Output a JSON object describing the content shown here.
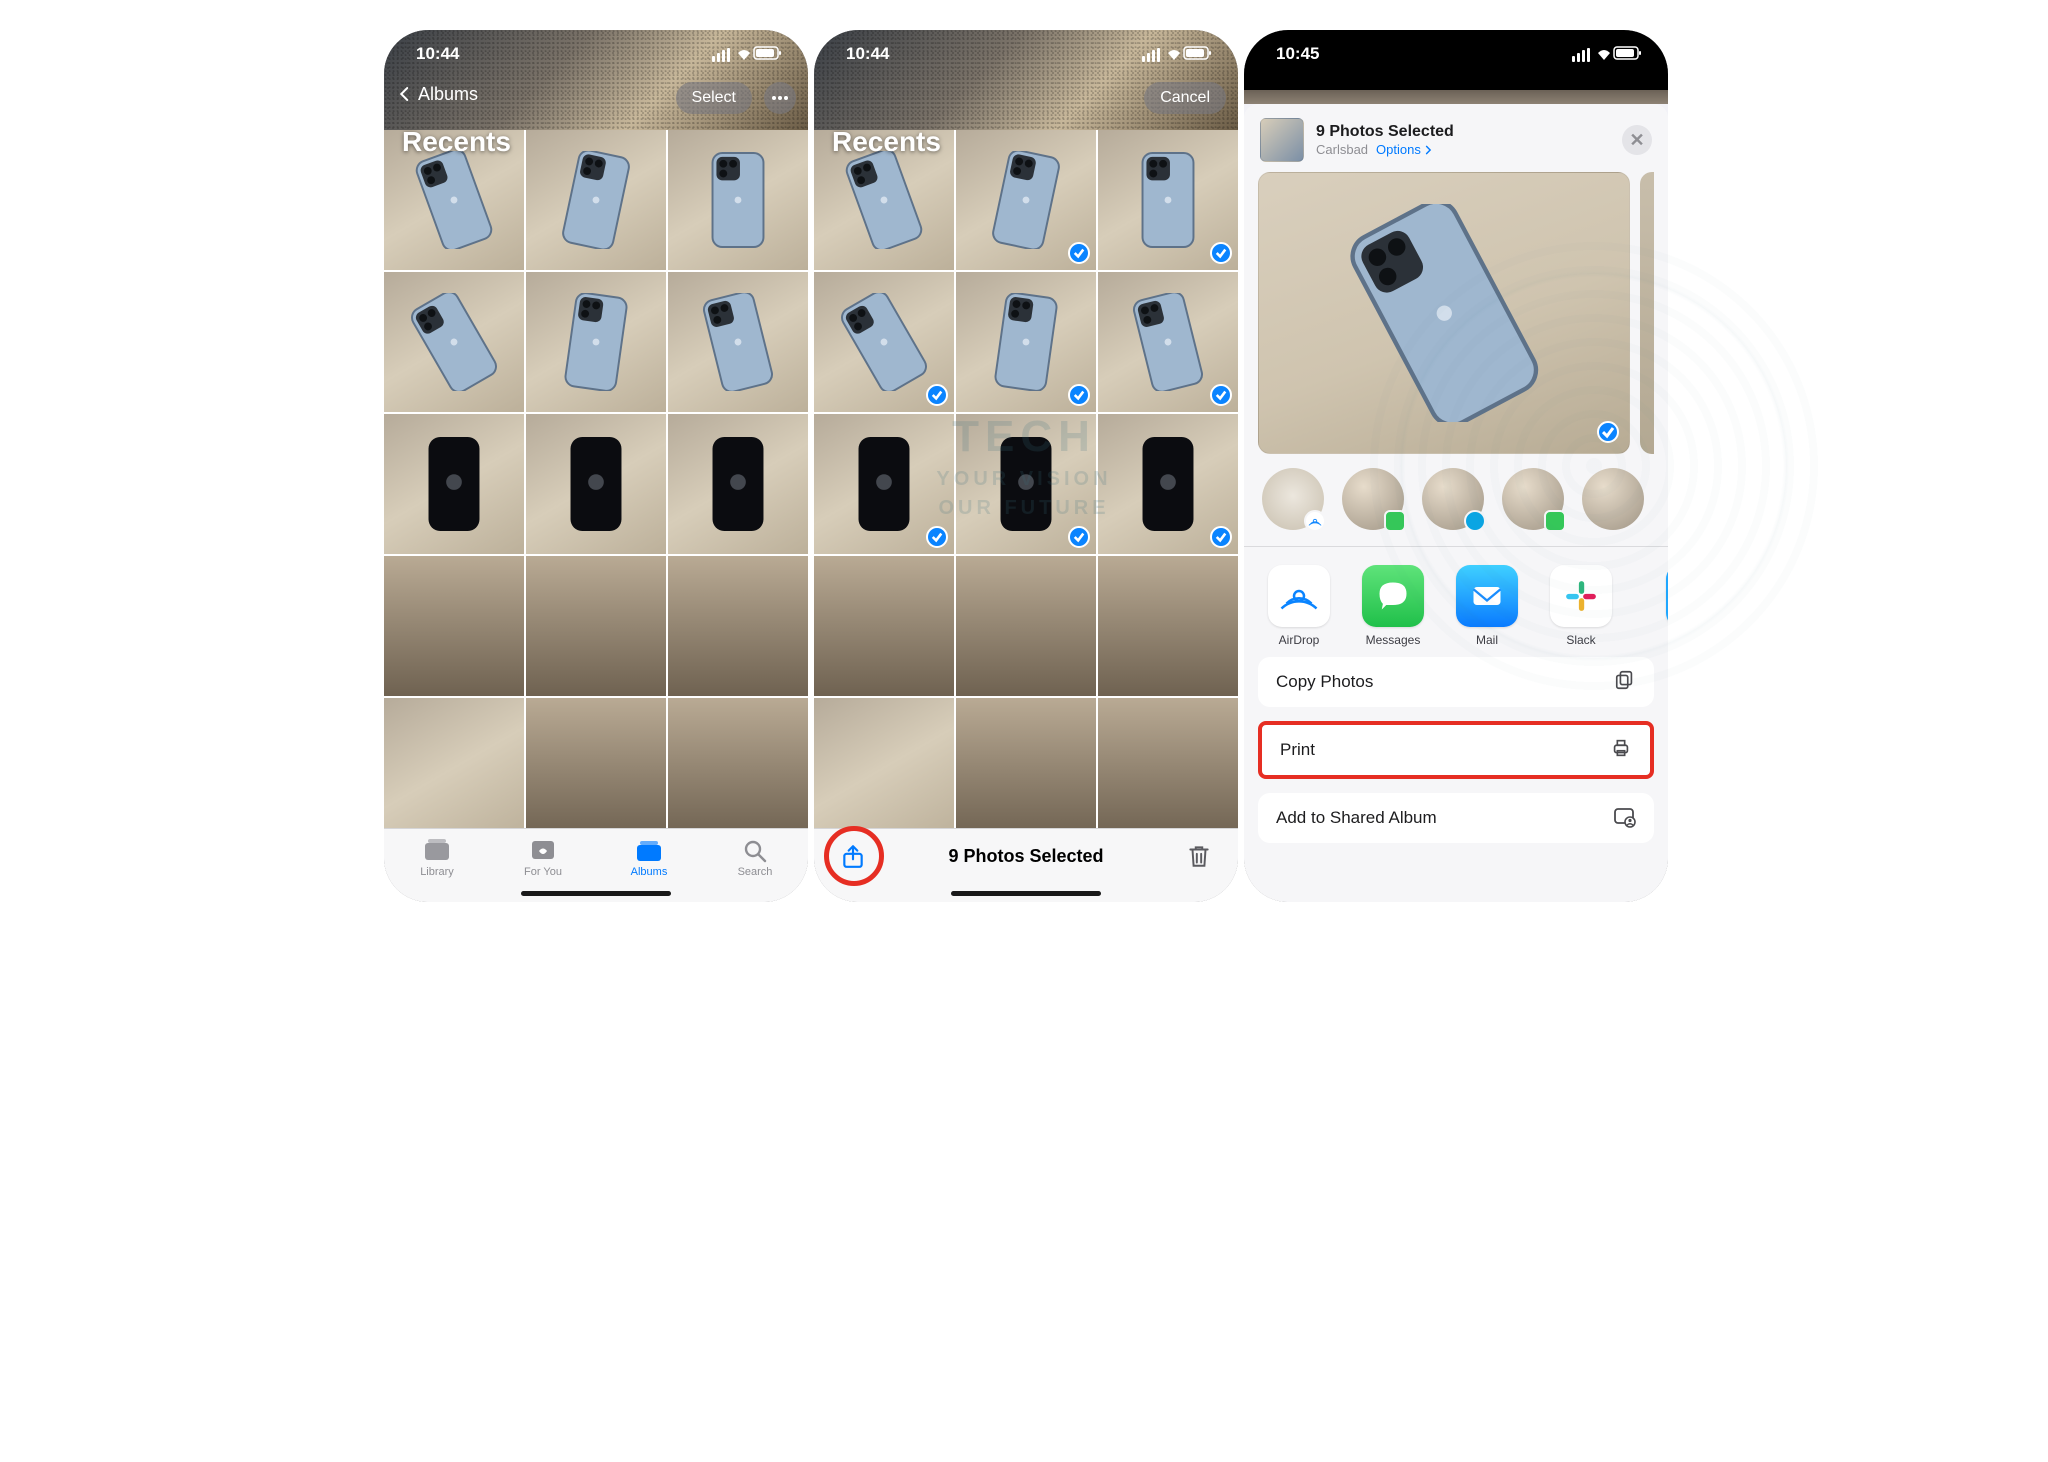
{
  "status": {
    "time_a": "10:44",
    "time_b": "10:44",
    "time_c": "10:45"
  },
  "screen1": {
    "back_label": "Albums",
    "title": "Recents",
    "select_label": "Select",
    "tabs": {
      "library": "Library",
      "foryou": "For You",
      "albums": "Albums",
      "search": "Search"
    }
  },
  "screen2": {
    "title": "Recents",
    "cancel_label": "Cancel",
    "selected_text": "9 Photos Selected",
    "selected_indices": [
      1,
      2,
      3,
      4,
      5,
      6,
      7,
      8
    ]
  },
  "screen3": {
    "header_title": "9 Photos Selected",
    "header_location": "Carlsbad",
    "header_options": "Options",
    "apps": {
      "airdrop": "AirDrop",
      "messages": "Messages",
      "mail": "Mail",
      "slack": "Slack"
    },
    "actions": {
      "copy": "Copy Photos",
      "print": "Print",
      "add_shared": "Add to Shared Album"
    }
  },
  "watermark": {
    "line1": "TECH",
    "line2_a": "YOUR VISION",
    "line2_b": "OUR FUTURE"
  },
  "colors": {
    "accent_red": "#e62e23",
    "ios_blue": "#007aff",
    "check_blue": "#0a84ff"
  }
}
